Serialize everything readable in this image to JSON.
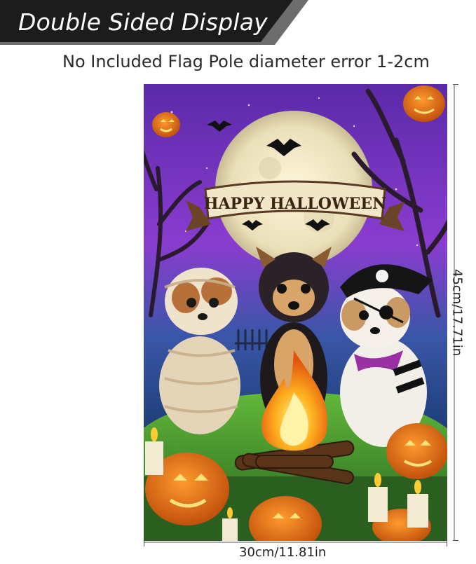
{
  "banner": {
    "text": "Double Sided Display"
  },
  "subtitle": "No Included Flag Pole diameter error 1-2cm",
  "flag": {
    "ribbon_text": "HAPPY HALLOWEEN"
  },
  "dimensions": {
    "width_label": "30cm/11.81in",
    "height_label": "45cm/17.71in"
  },
  "colors": {
    "banner_bg": "#1c1c1c",
    "banner_accent": "#6d6d6d",
    "sky_top": "#6b2fbe",
    "moon": "#efe6c4",
    "pumpkin": "#e46a12",
    "grass": "#3f9a2c"
  }
}
